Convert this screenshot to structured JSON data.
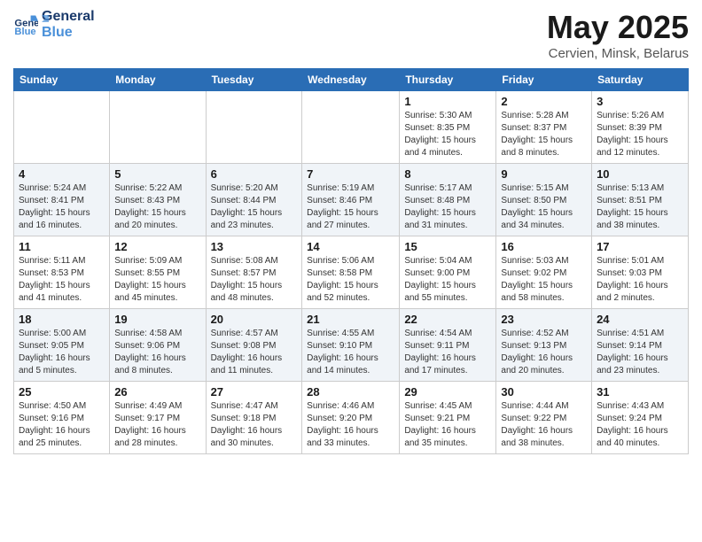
{
  "logo": {
    "line1": "General",
    "line2": "Blue"
  },
  "title": "May 2025",
  "subtitle": "Cervien, Minsk, Belarus",
  "headers": [
    "Sunday",
    "Monday",
    "Tuesday",
    "Wednesday",
    "Thursday",
    "Friday",
    "Saturday"
  ],
  "weeks": [
    [
      {
        "day": "",
        "info": ""
      },
      {
        "day": "",
        "info": ""
      },
      {
        "day": "",
        "info": ""
      },
      {
        "day": "",
        "info": ""
      },
      {
        "day": "1",
        "info": "Sunrise: 5:30 AM\nSunset: 8:35 PM\nDaylight: 15 hours\nand 4 minutes."
      },
      {
        "day": "2",
        "info": "Sunrise: 5:28 AM\nSunset: 8:37 PM\nDaylight: 15 hours\nand 8 minutes."
      },
      {
        "day": "3",
        "info": "Sunrise: 5:26 AM\nSunset: 8:39 PM\nDaylight: 15 hours\nand 12 minutes."
      }
    ],
    [
      {
        "day": "4",
        "info": "Sunrise: 5:24 AM\nSunset: 8:41 PM\nDaylight: 15 hours\nand 16 minutes."
      },
      {
        "day": "5",
        "info": "Sunrise: 5:22 AM\nSunset: 8:43 PM\nDaylight: 15 hours\nand 20 minutes."
      },
      {
        "day": "6",
        "info": "Sunrise: 5:20 AM\nSunset: 8:44 PM\nDaylight: 15 hours\nand 23 minutes."
      },
      {
        "day": "7",
        "info": "Sunrise: 5:19 AM\nSunset: 8:46 PM\nDaylight: 15 hours\nand 27 minutes."
      },
      {
        "day": "8",
        "info": "Sunrise: 5:17 AM\nSunset: 8:48 PM\nDaylight: 15 hours\nand 31 minutes."
      },
      {
        "day": "9",
        "info": "Sunrise: 5:15 AM\nSunset: 8:50 PM\nDaylight: 15 hours\nand 34 minutes."
      },
      {
        "day": "10",
        "info": "Sunrise: 5:13 AM\nSunset: 8:51 PM\nDaylight: 15 hours\nand 38 minutes."
      }
    ],
    [
      {
        "day": "11",
        "info": "Sunrise: 5:11 AM\nSunset: 8:53 PM\nDaylight: 15 hours\nand 41 minutes."
      },
      {
        "day": "12",
        "info": "Sunrise: 5:09 AM\nSunset: 8:55 PM\nDaylight: 15 hours\nand 45 minutes."
      },
      {
        "day": "13",
        "info": "Sunrise: 5:08 AM\nSunset: 8:57 PM\nDaylight: 15 hours\nand 48 minutes."
      },
      {
        "day": "14",
        "info": "Sunrise: 5:06 AM\nSunset: 8:58 PM\nDaylight: 15 hours\nand 52 minutes."
      },
      {
        "day": "15",
        "info": "Sunrise: 5:04 AM\nSunset: 9:00 PM\nDaylight: 15 hours\nand 55 minutes."
      },
      {
        "day": "16",
        "info": "Sunrise: 5:03 AM\nSunset: 9:02 PM\nDaylight: 15 hours\nand 58 minutes."
      },
      {
        "day": "17",
        "info": "Sunrise: 5:01 AM\nSunset: 9:03 PM\nDaylight: 16 hours\nand 2 minutes."
      }
    ],
    [
      {
        "day": "18",
        "info": "Sunrise: 5:00 AM\nSunset: 9:05 PM\nDaylight: 16 hours\nand 5 minutes."
      },
      {
        "day": "19",
        "info": "Sunrise: 4:58 AM\nSunset: 9:06 PM\nDaylight: 16 hours\nand 8 minutes."
      },
      {
        "day": "20",
        "info": "Sunrise: 4:57 AM\nSunset: 9:08 PM\nDaylight: 16 hours\nand 11 minutes."
      },
      {
        "day": "21",
        "info": "Sunrise: 4:55 AM\nSunset: 9:10 PM\nDaylight: 16 hours\nand 14 minutes."
      },
      {
        "day": "22",
        "info": "Sunrise: 4:54 AM\nSunset: 9:11 PM\nDaylight: 16 hours\nand 17 minutes."
      },
      {
        "day": "23",
        "info": "Sunrise: 4:52 AM\nSunset: 9:13 PM\nDaylight: 16 hours\nand 20 minutes."
      },
      {
        "day": "24",
        "info": "Sunrise: 4:51 AM\nSunset: 9:14 PM\nDaylight: 16 hours\nand 23 minutes."
      }
    ],
    [
      {
        "day": "25",
        "info": "Sunrise: 4:50 AM\nSunset: 9:16 PM\nDaylight: 16 hours\nand 25 minutes."
      },
      {
        "day": "26",
        "info": "Sunrise: 4:49 AM\nSunset: 9:17 PM\nDaylight: 16 hours\nand 28 minutes."
      },
      {
        "day": "27",
        "info": "Sunrise: 4:47 AM\nSunset: 9:18 PM\nDaylight: 16 hours\nand 30 minutes."
      },
      {
        "day": "28",
        "info": "Sunrise: 4:46 AM\nSunset: 9:20 PM\nDaylight: 16 hours\nand 33 minutes."
      },
      {
        "day": "29",
        "info": "Sunrise: 4:45 AM\nSunset: 9:21 PM\nDaylight: 16 hours\nand 35 minutes."
      },
      {
        "day": "30",
        "info": "Sunrise: 4:44 AM\nSunset: 9:22 PM\nDaylight: 16 hours\nand 38 minutes."
      },
      {
        "day": "31",
        "info": "Sunrise: 4:43 AM\nSunset: 9:24 PM\nDaylight: 16 hours\nand 40 minutes."
      }
    ]
  ],
  "colors": {
    "header_bg": "#2a6db5",
    "alt_row_bg": "#f0f4f8"
  }
}
